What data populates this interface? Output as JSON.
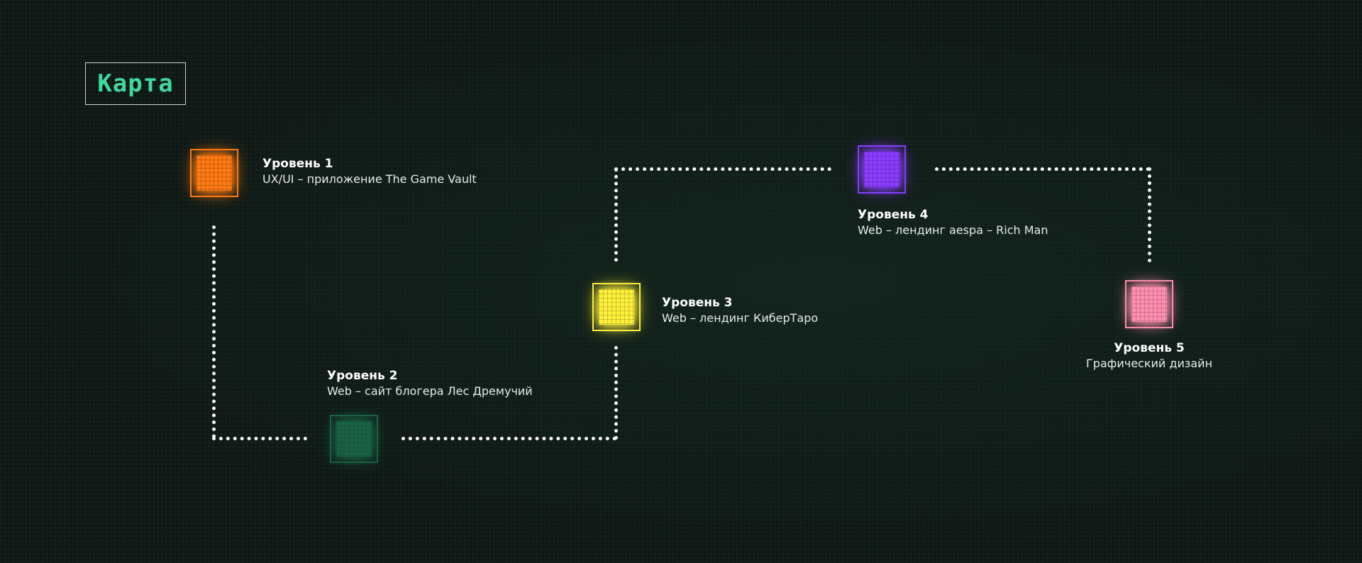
{
  "map": {
    "title": "Карта"
  },
  "levels": [
    {
      "title": "Уровень 1",
      "description": "UX/UI – приложение The Game Vault",
      "color": "#ff7a12"
    },
    {
      "title": "Уровень 2",
      "description": "Web – сайт блогера Лес Дремучий",
      "color": "#1f9e6c"
    },
    {
      "title": "Уровень 3",
      "description": "Web – лендинг КиберТаро",
      "color": "#fff03a"
    },
    {
      "title": "Уровень 4",
      "description": "Web – лендинг aespa – Rich Man",
      "color": "#8a3cff"
    },
    {
      "title": "Уровень 5",
      "description": "Графический дизайн",
      "color": "#ff8fb0"
    }
  ]
}
